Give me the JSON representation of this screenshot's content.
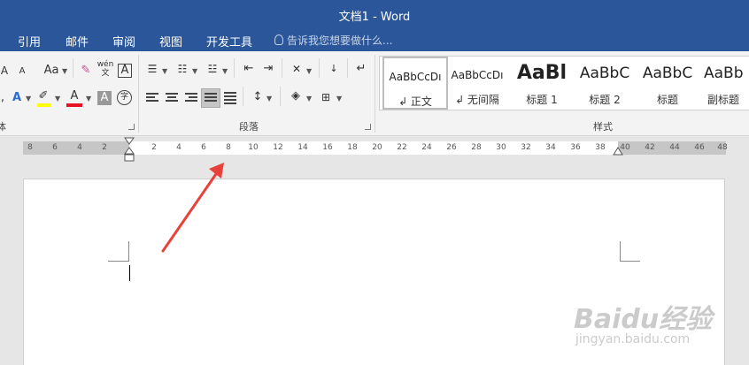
{
  "window": {
    "title": "文档1 - Word"
  },
  "menu": {
    "tabs": [
      {
        "label": "引用"
      },
      {
        "label": "邮件"
      },
      {
        "label": "审阅"
      },
      {
        "label": "视图"
      },
      {
        "label": "开发工具"
      }
    ],
    "tell_me_placeholder": "告诉我您想要做什么..."
  },
  "ribbon": {
    "groups": {
      "font_partial_label": "体",
      "paragraph_label": "段落",
      "styles_label": "样式"
    },
    "font": {
      "grow_font": "A",
      "shrink_font": "A",
      "change_case": "Aa",
      "phonetic_guide": "wén 文",
      "char_border": "A",
      "text_effects": "A",
      "font_color": "A",
      "char_shading": "A",
      "enclose_chars": "字",
      "highlight_color": "#ffff00",
      "font_color_value": "#e81123"
    },
    "styles": [
      {
        "preview": "AaBbCcDı",
        "name": "↲ 正文",
        "selected": true
      },
      {
        "preview": "AaBbCcDı",
        "name": "↲ 无间隔",
        "selected": false
      },
      {
        "preview": "AaBl",
        "name": "标题 1",
        "selected": false
      },
      {
        "preview": "AaBbC",
        "name": "标题 2",
        "selected": false
      },
      {
        "preview": "AaBbC",
        "name": "标题",
        "selected": false
      },
      {
        "preview": "AaBb",
        "name": "副标题",
        "selected": false
      }
    ]
  },
  "ruler": {
    "left_numbers": [
      "8",
      "6",
      "4",
      "2"
    ],
    "right_numbers": [
      "2",
      "4",
      "6",
      "8",
      "10",
      "12",
      "14",
      "16",
      "18",
      "20",
      "22",
      "24",
      "26",
      "28",
      "30",
      "32",
      "34",
      "36",
      "38",
      "40",
      "42",
      "44",
      "46",
      "48"
    ]
  },
  "watermark": {
    "brand": "Baidu经验",
    "url": "jingyan.baidu.com"
  },
  "colors": {
    "title_bar": "#2b579a",
    "arrow": "#e8413a"
  }
}
